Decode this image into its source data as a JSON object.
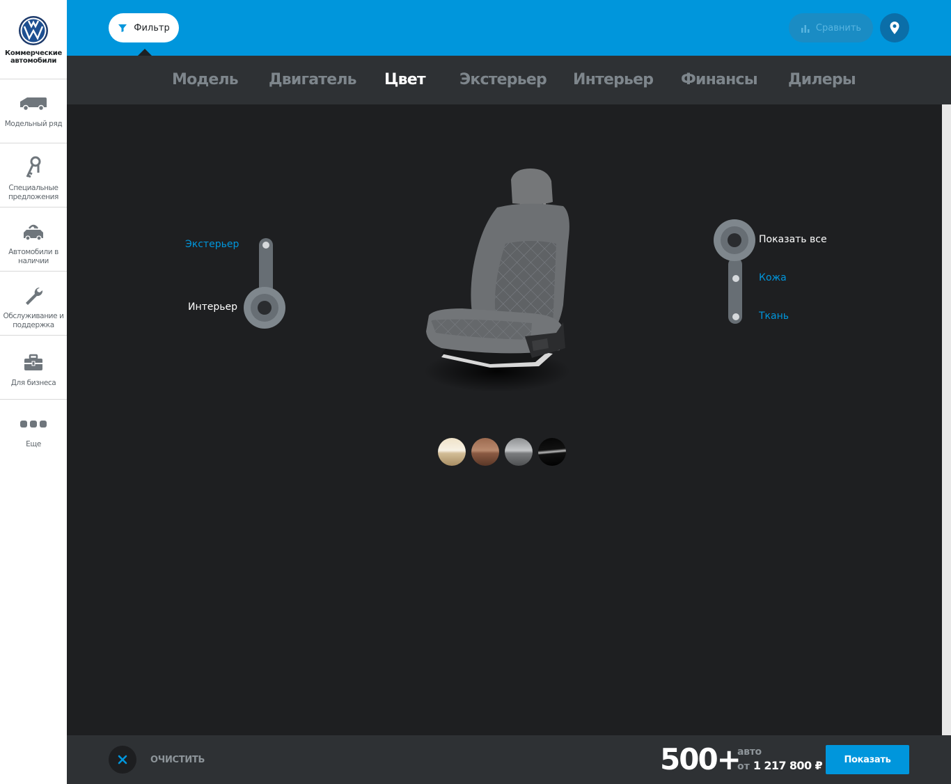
{
  "brand": {
    "logo_text_line1": "Коммерческие",
    "logo_text_line2": "автомобили"
  },
  "sidebar": {
    "items": [
      {
        "label": "Модельный ряд",
        "icon": "van-icon"
      },
      {
        "label": "Специальные предложения",
        "icon": "keys-icon"
      },
      {
        "label": "Автомобили в наличии",
        "icon": "car-stock-icon"
      },
      {
        "label": "Обслуживание и поддержка",
        "icon": "wrench-icon"
      },
      {
        "label": "Для бизнеса",
        "icon": "briefcase-icon"
      },
      {
        "label": "Еще",
        "icon": "more-icon"
      }
    ]
  },
  "header": {
    "filter_label": "Фильтр",
    "compare_label": "Сравнить"
  },
  "tabs": [
    {
      "label": "Модель",
      "active": false
    },
    {
      "label": "Двигатель",
      "active": false
    },
    {
      "label": "Цвет",
      "active": true
    },
    {
      "label": "Экстерьер",
      "active": false
    },
    {
      "label": "Интерьер",
      "active": false
    },
    {
      "label": "Финансы",
      "active": false
    },
    {
      "label": "Дилеры",
      "active": false
    }
  ],
  "color_mode": {
    "options": [
      "Экстерьер",
      "Интерьер"
    ],
    "selected": "Интерьер"
  },
  "upholstery": {
    "options": [
      "Показать все",
      "Кожа",
      "Ткань"
    ],
    "selected": "Показать все"
  },
  "swatches": [
    {
      "name": "beige",
      "color": "#d9c7a6"
    },
    {
      "name": "brown",
      "color": "#8a5a43"
    },
    {
      "name": "gray",
      "color": "#8e9092"
    },
    {
      "name": "black",
      "color": "#0a0a0a"
    }
  ],
  "footer": {
    "clear_label": "ОЧИСТИТЬ",
    "count": "500+",
    "count_unit": "авто",
    "price_from": "от",
    "price": "1 217 800 ₽",
    "show_label": "Показать"
  },
  "colors": {
    "accent": "#0096dc",
    "dark_bg": "#1e1f21",
    "bar_bg": "#2e3134"
  }
}
